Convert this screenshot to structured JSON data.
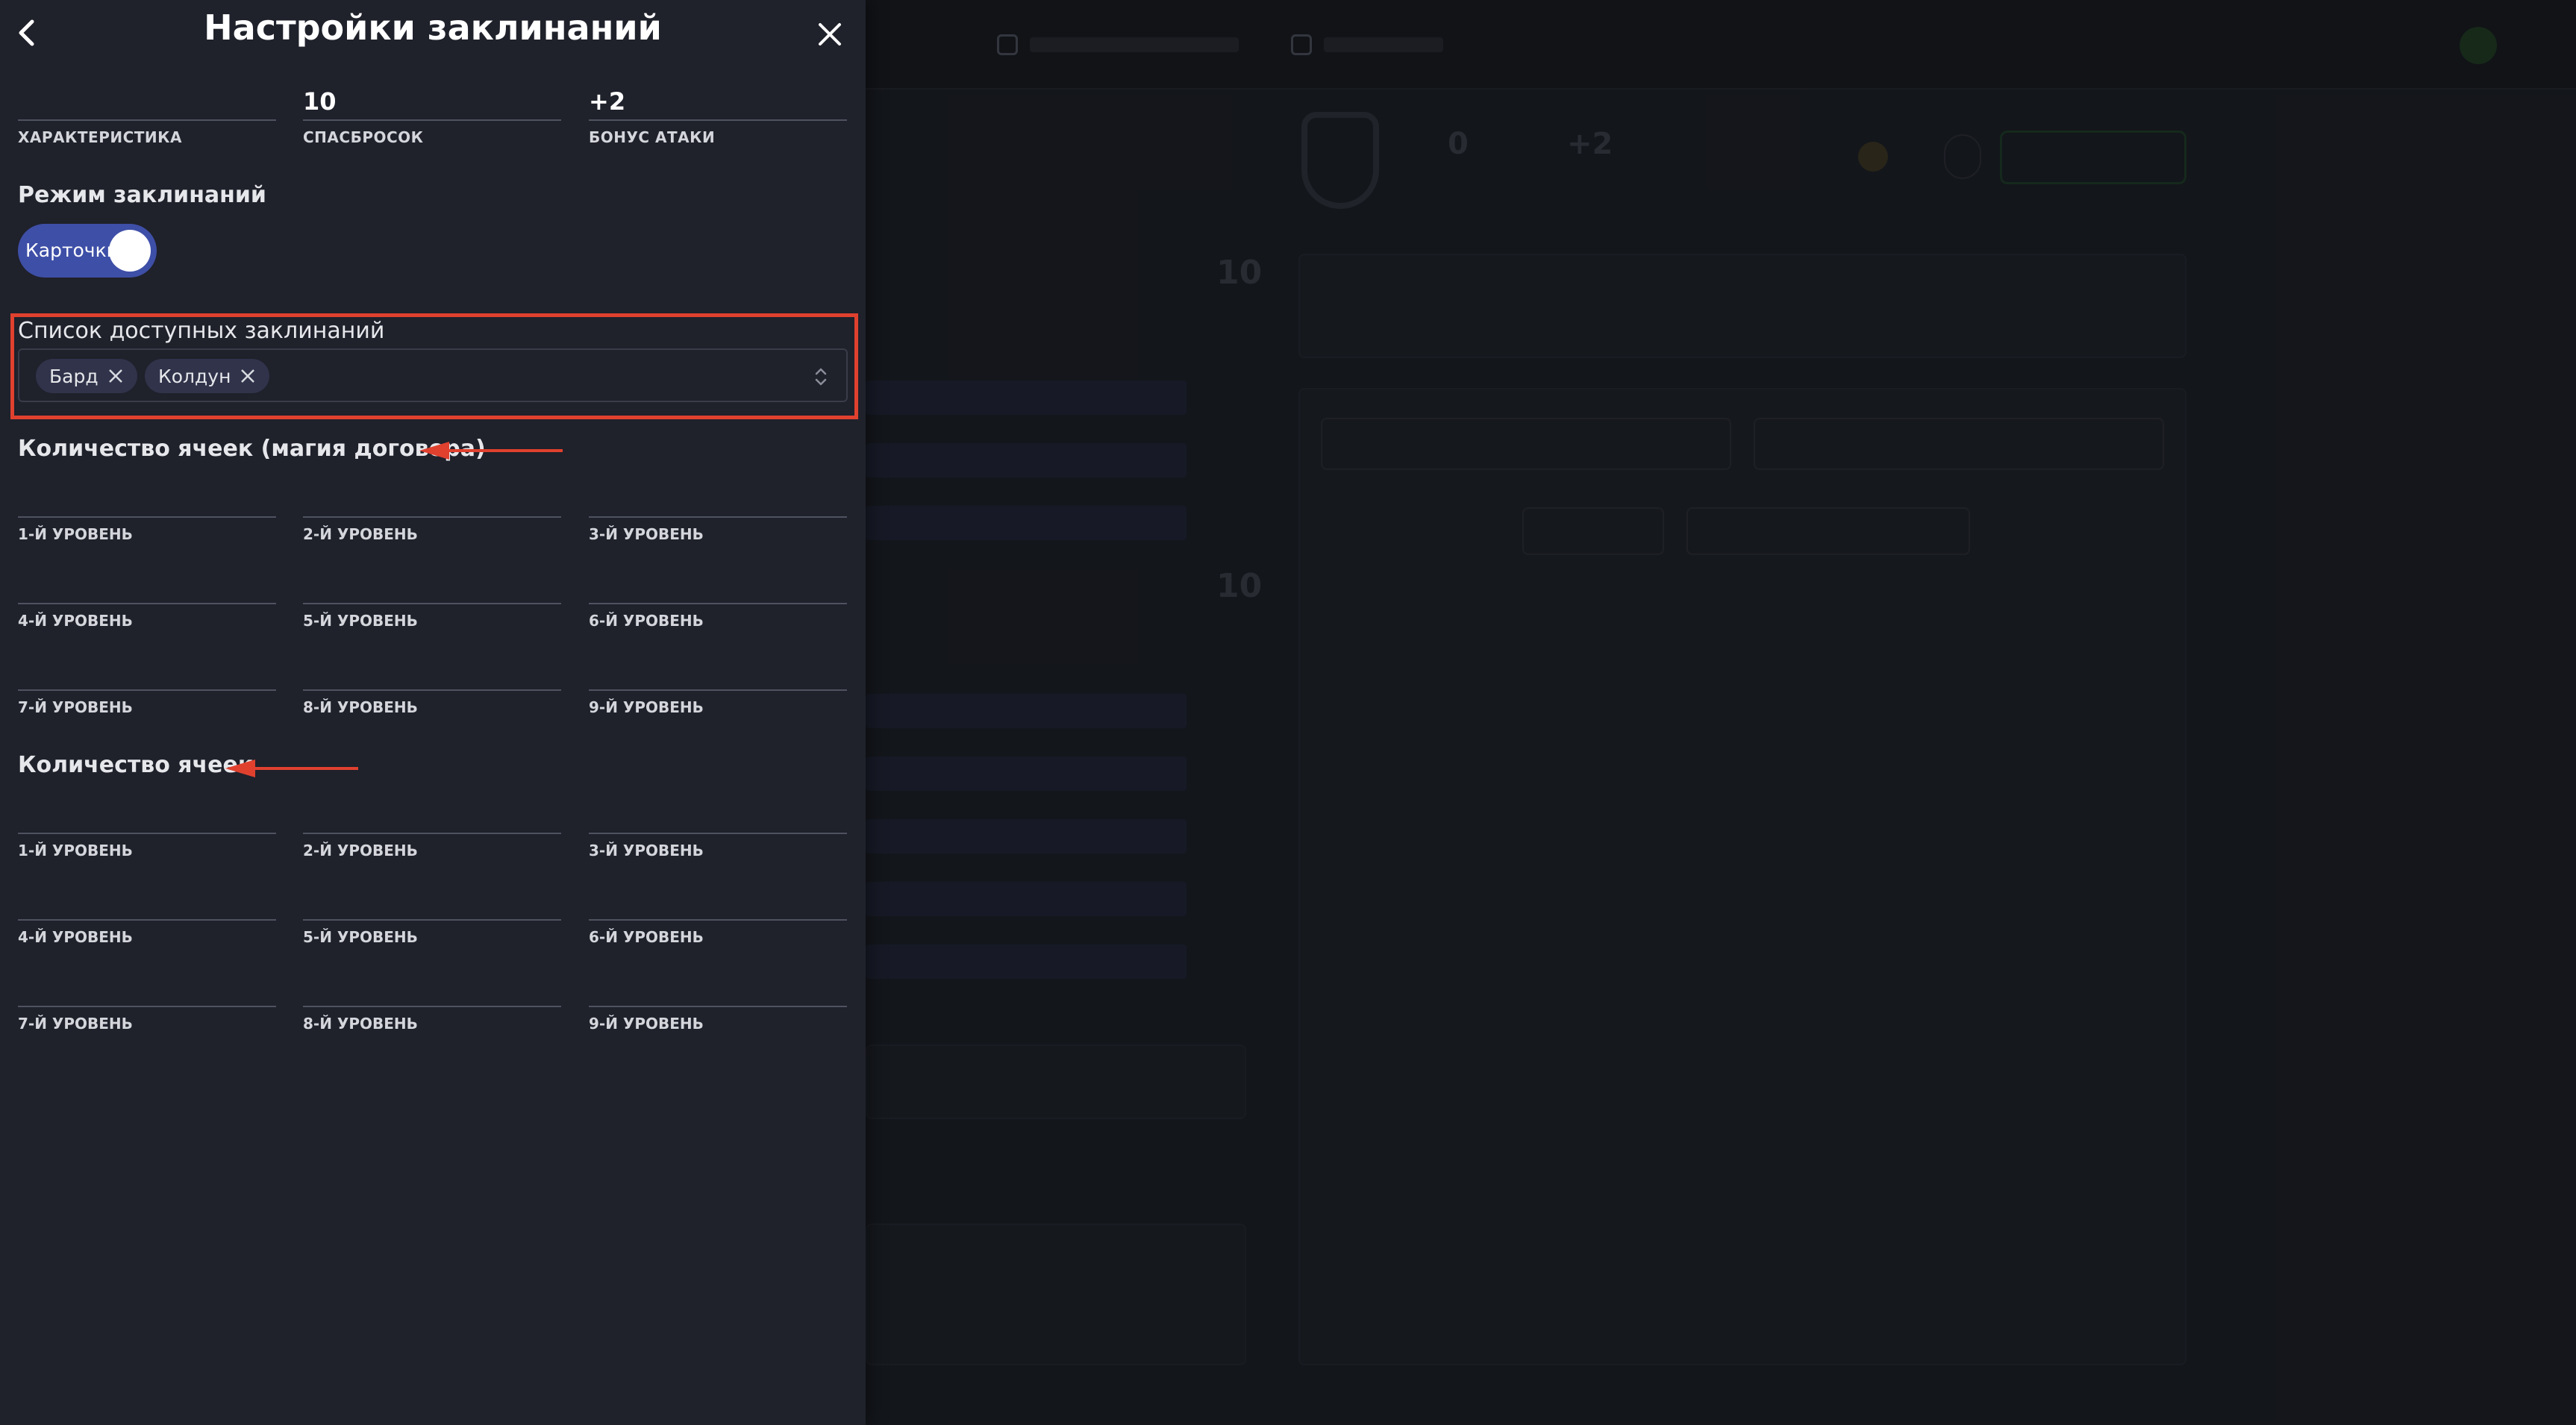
{
  "drawer": {
    "title": "Настройки заклинаний",
    "back_icon": "chevron-left-icon",
    "close_icon": "close-icon"
  },
  "stats": [
    {
      "value": "",
      "label": "ХАРАКТЕРИСТИКА"
    },
    {
      "value": "10",
      "label": "СПАСБРОСОК"
    },
    {
      "value": "+2",
      "label": "БОНУС АТАКИ"
    }
  ],
  "mode": {
    "heading": "Режим заклинаний",
    "toggle_label": "Карточки",
    "toggle_on": true
  },
  "spell_lists": {
    "label": "Список доступных заклинаний",
    "tags": [
      {
        "text": "Бард"
      },
      {
        "text": "Колдун"
      }
    ]
  },
  "pact_slots": {
    "heading": "Количество ячеек (магия договора)",
    "levels": [
      "1-Й УРОВЕНЬ",
      "2-Й УРОВЕНЬ",
      "3-Й УРОВЕНЬ",
      "4-Й УРОВЕНЬ",
      "5-Й УРОВЕНЬ",
      "6-Й УРОВЕНЬ",
      "7-Й УРОВЕНЬ",
      "8-Й УРОВЕНЬ",
      "9-Й УРОВЕНЬ"
    ]
  },
  "slots": {
    "heading": "Количество ячеек",
    "levels": [
      "1-Й УРОВЕНЬ",
      "2-Й УРОВЕНЬ",
      "3-Й УРОВЕНЬ",
      "4-Й УРОВЕНЬ",
      "5-Й УРОВЕНЬ",
      "6-Й УРОВЕНЬ",
      "7-Й УРОВЕНЬ",
      "8-Й УРОВЕНЬ",
      "9-Й УРОВЕНЬ"
    ]
  },
  "colors": {
    "drawer_bg": "#1f212b",
    "toggle_accent": "#3e4fa7",
    "annotation_red": "#e0412f",
    "tag_bg": "#30334a"
  }
}
